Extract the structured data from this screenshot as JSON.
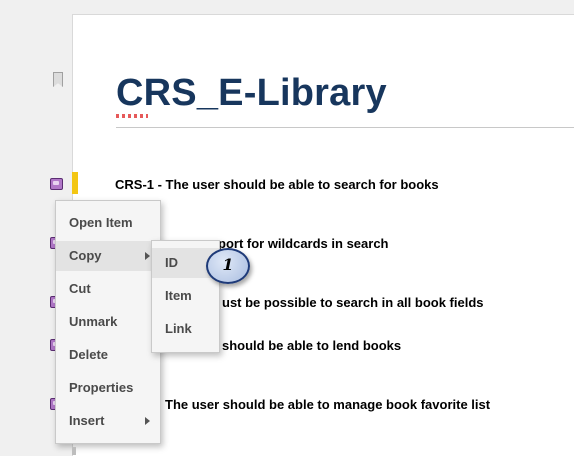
{
  "document": {
    "title": "CRS_E-Library"
  },
  "requirements": [
    {
      "text": "CRS-1 - The user should be able to search for books"
    },
    {
      "text": "port for wildcards in search"
    },
    {
      "text": "ust be possible to search in all book fields"
    },
    {
      "text": "should be able to lend books"
    },
    {
      "text": "The user should be able to manage book favorite list"
    }
  ],
  "context_menu": {
    "items": [
      {
        "label": "Open Item"
      },
      {
        "label": "Copy",
        "has_submenu": true
      },
      {
        "label": "Cut"
      },
      {
        "label": "Unmark"
      },
      {
        "label": "Delete"
      },
      {
        "label": "Properties"
      },
      {
        "label": "Insert",
        "has_submenu": true
      }
    ]
  },
  "copy_submenu": {
    "items": [
      {
        "label": "ID"
      },
      {
        "label": "Item"
      },
      {
        "label": "Link"
      }
    ]
  },
  "callout": {
    "label": "1"
  },
  "colors": {
    "title": "#17365d",
    "selection_bar": "#f3c613",
    "requirement_icon": "#b077c7",
    "callout_border": "#1e3a78"
  },
  "icons": [
    "bookmark-icon",
    "requirement-icon",
    "submenu-arrow-icon"
  ]
}
